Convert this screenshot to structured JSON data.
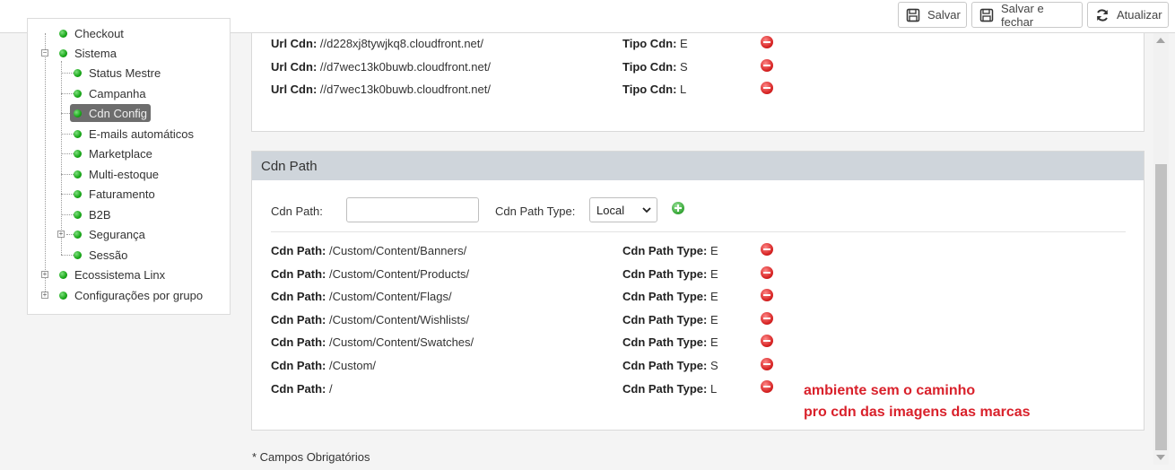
{
  "toolbar": {
    "save_label": "Salvar",
    "save_close_label": "Salvar e fechar",
    "refresh_label": "Atualizar"
  },
  "tree": {
    "checkout_label": "Checkout",
    "sistema_label": "Sistema",
    "sistema_children": [
      "Status Mestre",
      "Campanha",
      "Cdn Config",
      "E-mails automáticos",
      "Marketplace",
      "Multi-estoque",
      "Faturamento",
      "B2B",
      "Segurança",
      "Sessão"
    ],
    "ecossistema_label": "Ecossistema Linx",
    "config_grupo_label": "Configurações por grupo",
    "selected": "Cdn Config"
  },
  "cdn_urls": {
    "url_label": "Url Cdn:",
    "type_label": "Tipo Cdn:",
    "rows": [
      {
        "url": "//d228xj8tywjkq8.cloudfront.net/",
        "type": "E"
      },
      {
        "url": "//d7wec13k0buwb.cloudfront.net/",
        "type": "S"
      },
      {
        "url": "//d7wec13k0buwb.cloudfront.net/",
        "type": "L"
      }
    ]
  },
  "cdn_path": {
    "title": "Cdn Path",
    "form_path_label": "Cdn Path:",
    "form_path_value": "",
    "form_type_label": "Cdn Path Type:",
    "form_type_selected": "Local",
    "path_label": "Cdn Path:",
    "type_label": "Cdn Path Type:",
    "rows": [
      {
        "path": "/Custom/Content/Banners/",
        "type": "E"
      },
      {
        "path": "/Custom/Content/Products/",
        "type": "E"
      },
      {
        "path": "/Custom/Content/Flags/",
        "type": "E"
      },
      {
        "path": "/Custom/Content/Wishlists/",
        "type": "E"
      },
      {
        "path": "/Custom/Content/Swatches/",
        "type": "E"
      },
      {
        "path": "/Custom/",
        "type": "S"
      },
      {
        "path": "/",
        "type": "L"
      }
    ]
  },
  "annotation": {
    "line1": "ambiente sem o caminho",
    "line2": "pro cdn das imagens das marcas",
    "color": "#d9212b"
  },
  "footnote": "* Campos Obrigatórios",
  "colors": {
    "header_bg": "#cfd5db",
    "status_green": "#17a617",
    "delete_red": "#d62222",
    "selected_node_bg": "#6d6d6d"
  }
}
